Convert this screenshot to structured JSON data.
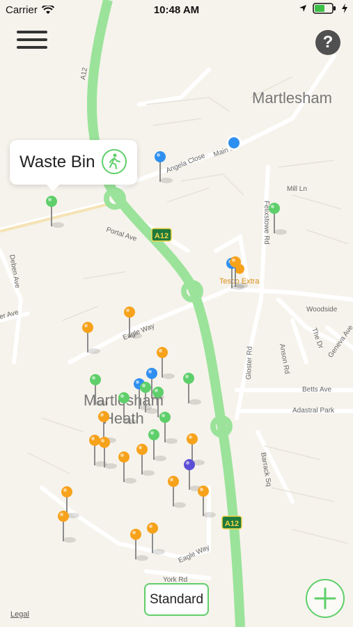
{
  "status": {
    "carrier": "Carrier",
    "time": "10:48 AM"
  },
  "map": {
    "place_labels": [
      "Martlesham",
      "Martlesham",
      "Heath"
    ],
    "road_labels": [
      "A12",
      "Angela Close",
      "Main Rd",
      "Mill Ln",
      "Felixstowe Rd",
      "Portal Ave",
      "Deben Ave",
      "Eagle Way",
      "Woodside",
      "The Dr",
      "Geneva Ave",
      "Gloster Rd",
      "Anson Rd",
      "Betts Ave",
      "Adastral Park",
      "Barrack Sq",
      "Eagle Way",
      "York Rd",
      "er Ave"
    ],
    "road_badges": [
      "A12",
      "A12"
    ],
    "poi": "Tesco Extra"
  },
  "callout": {
    "title": "Waste Bin",
    "walk_icon": "walking-person-icon"
  },
  "controls": {
    "menu_icon": "hamburger-menu-icon",
    "help_icon": "help-icon",
    "help_label": "?",
    "map_style_label": "Standard",
    "add_icon": "plus-icon",
    "legal_label": "Legal"
  },
  "pins": [
    {
      "id": "p1",
      "color": "green"
    },
    {
      "id": "p2",
      "color": "blue"
    },
    {
      "id": "p3",
      "color": "green"
    },
    {
      "id": "p4",
      "color": "blue"
    },
    {
      "id": "p5",
      "color": "orange"
    },
    {
      "id": "p6",
      "color": "orange"
    },
    {
      "id": "p7",
      "color": "orange"
    },
    {
      "id": "p8",
      "color": "blue"
    },
    {
      "id": "p9",
      "color": "green"
    },
    {
      "id": "p10",
      "color": "blue"
    },
    {
      "id": "p11",
      "color": "green"
    },
    {
      "id": "p12",
      "color": "green"
    },
    {
      "id": "p13",
      "color": "green"
    },
    {
      "id": "p14",
      "color": "green"
    },
    {
      "id": "p15",
      "color": "green"
    },
    {
      "id": "p16",
      "color": "orange"
    },
    {
      "id": "p17",
      "color": "orange"
    },
    {
      "id": "p18",
      "color": "orange"
    },
    {
      "id": "p19",
      "color": "orange"
    },
    {
      "id": "p20",
      "color": "orange"
    },
    {
      "id": "p21",
      "color": "orange"
    },
    {
      "id": "p22",
      "color": "green"
    },
    {
      "id": "p23",
      "color": "purple"
    },
    {
      "id": "p24",
      "color": "orange"
    },
    {
      "id": "p25",
      "color": "orange"
    },
    {
      "id": "p26",
      "color": "orange"
    },
    {
      "id": "p27",
      "color": "orange"
    },
    {
      "id": "p28",
      "color": "orange"
    },
    {
      "id": "p29",
      "color": "orange"
    },
    {
      "id": "p30",
      "color": "orange"
    }
  ],
  "colors": {
    "green": "#5ecf6a",
    "blue": "#2f8ff0",
    "orange": "#f7a21b",
    "purple": "#5b4fd6",
    "road": "#9be39a",
    "background": "#f6f3ec",
    "minor_road": "#ffffff"
  }
}
